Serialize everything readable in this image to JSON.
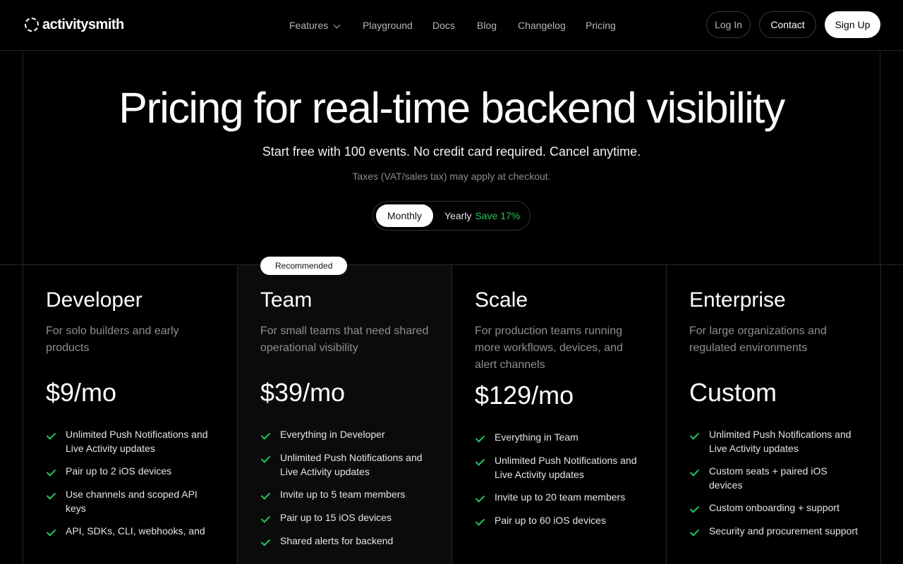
{
  "nav": {
    "logo": "activitysmith",
    "links": [
      "Features",
      "Playground",
      "Docs",
      "Blog",
      "Changelog",
      "Pricing"
    ],
    "login": "Log In",
    "contact": "Contact",
    "signup": "Sign Up"
  },
  "hero": {
    "title": "Pricing for real-time backend visibility",
    "subtitle": "Start free with 100 events. No credit card required. Cancel anytime.",
    "tax_note": "Taxes (VAT/sales tax) may apply at checkout.",
    "toggle": {
      "monthly": "Monthly",
      "yearly": "Yearly",
      "save": "Save 17%"
    }
  },
  "plans": [
    {
      "name": "Developer",
      "desc": "For solo builders and early products",
      "price": "$9/mo",
      "features": [
        "Unlimited Push Notifications and Live Activity updates",
        "Pair up to 2 iOS devices",
        "Use channels and scoped API keys",
        "API, SDKs, CLI, webhooks, and"
      ]
    },
    {
      "name": "Team",
      "badge": "Recommended",
      "desc": "For small teams that need shared operational visibility",
      "price": "$39/mo",
      "features": [
        "Everything in Developer",
        "Unlimited Push Notifications and Live Activity updates",
        "Invite up to 5 team members",
        "Pair up to 15 iOS devices",
        "Shared alerts for backend"
      ]
    },
    {
      "name": "Scale",
      "desc": "For production teams running more workflows, devices, and alert channels",
      "price": "$129/mo",
      "features": [
        "Everything in Team",
        "Unlimited Push Notifications and Live Activity updates",
        "Invite up to 20 team members",
        "Pair up to 60 iOS devices"
      ]
    },
    {
      "name": "Enterprise",
      "desc": "For large organizations and regulated environments",
      "price": "Custom",
      "features": [
        "Unlimited Push Notifications and Live Activity updates",
        "Custom seats + paired iOS devices",
        "Custom onboarding + support",
        "Security and procurement support"
      ]
    }
  ],
  "colors": {
    "accent_green": "#22c55e",
    "background": "#000000"
  }
}
